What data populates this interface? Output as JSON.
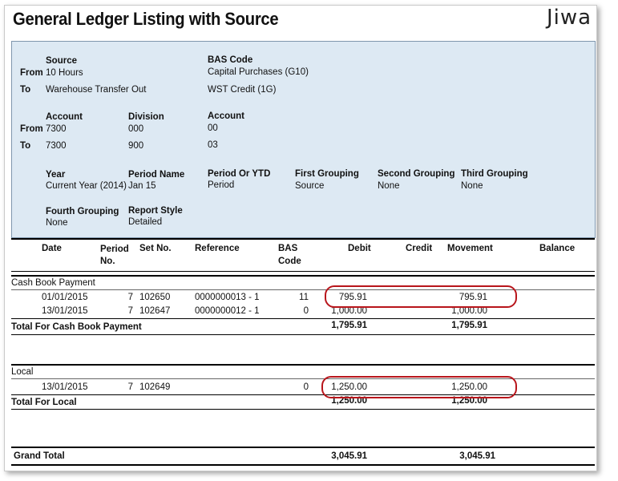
{
  "report": {
    "title": "General Ledger Listing with Source",
    "logo": "Jiwa"
  },
  "params": {
    "source_label": "Source",
    "bas_code_label": "BAS Code",
    "from_label": "From",
    "to_label": "To",
    "source_from": "10 Hours",
    "source_to": "Warehouse Transfer Out",
    "bas_from": "Capital Purchases (G10)",
    "bas_to": "WST Credit (1G)",
    "account_label": "Account",
    "division_label": "Division",
    "account2_label": "Account",
    "account_from": "7300",
    "account_to": "7300",
    "division_from": "000",
    "division_to": "900",
    "account2_from": "00",
    "account2_to": "03",
    "year_label": "Year",
    "year_value": "Current Year (2014)",
    "period_name_label": "Period Name",
    "period_name_value": "Jan 15",
    "period_or_ytd_label": "Period Or YTD",
    "period_or_ytd_value": "Period",
    "first_grouping_label": "First Grouping",
    "first_grouping_value": "Source",
    "second_grouping_label": "Second Grouping",
    "second_grouping_value": "None",
    "third_grouping_label": "Third Grouping",
    "third_grouping_value": "None",
    "fourth_grouping_label": "Fourth Grouping",
    "fourth_grouping_value": "None",
    "report_style_label": "Report Style",
    "report_style_value": "Detailed"
  },
  "columns": {
    "date": "Date",
    "period_1": "Period",
    "period_2": "No.",
    "set_no": "Set No.",
    "reference": "Reference",
    "bas_1": "BAS",
    "bas_2": "Code",
    "debit": "Debit",
    "credit": "Credit",
    "movement": "Movement",
    "balance": "Balance"
  },
  "groups": [
    {
      "name": "Cash Book Payment",
      "rows": [
        {
          "date": "01/01/2015",
          "period": "7",
          "set_no": "102650",
          "reference": "0000000013 - 1",
          "bas": "11",
          "debit": "795.91",
          "credit": "",
          "movement": "795.91",
          "balance": ""
        },
        {
          "date": "13/01/2015",
          "period": "7",
          "set_no": "102647",
          "reference": "0000000012 - 1",
          "bas": "0",
          "debit": "1,000.00",
          "credit": "",
          "movement": "1,000.00",
          "balance": ""
        }
      ],
      "total_label": "Total For Cash Book Payment",
      "total_debit": "1,795.91",
      "total_movement": "1,795.91"
    },
    {
      "name": "Local",
      "rows": [
        {
          "date": "13/01/2015",
          "period": "7",
          "set_no": "102649",
          "reference": "",
          "bas": "0",
          "debit": "1,250.00",
          "credit": "",
          "movement": "1,250.00",
          "balance": ""
        }
      ],
      "total_label": "Total For Local",
      "total_debit": "1,250.00",
      "total_movement": "1,250.00"
    }
  ],
  "grand_total": {
    "label": "Grand Total",
    "debit": "3,045.91",
    "movement": "3,045.91"
  },
  "annotation_color": "#b8151b"
}
